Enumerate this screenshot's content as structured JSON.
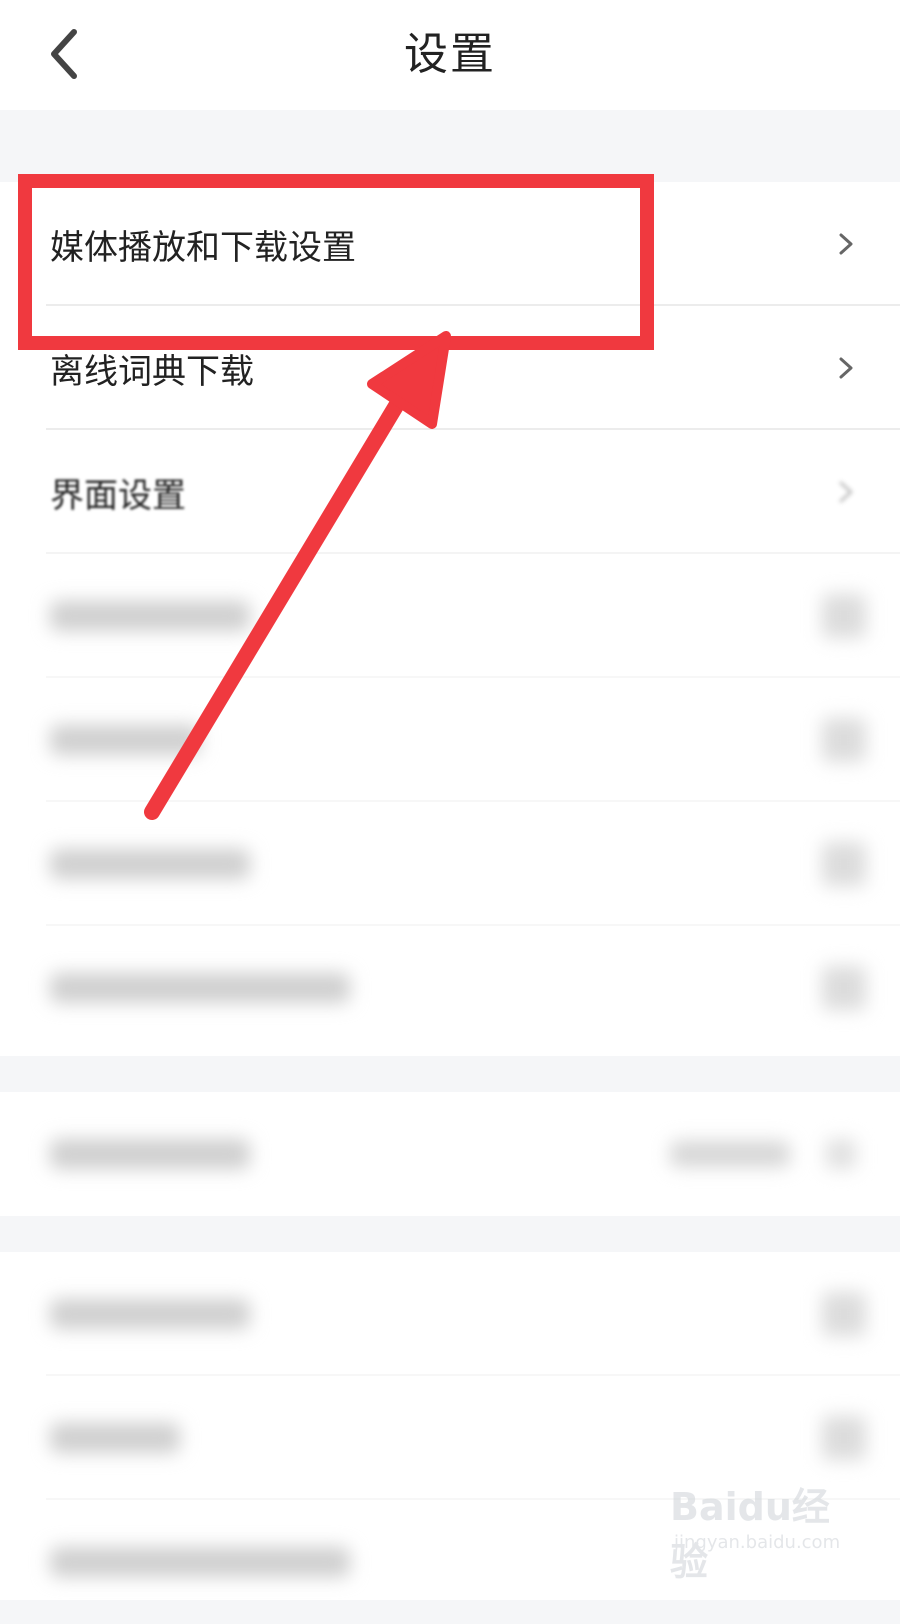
{
  "header": {
    "title": "设置",
    "back_icon": "chevron-left-icon"
  },
  "settings": {
    "group1": [
      {
        "label": "媒体播放和下载设置",
        "icon": "chevron-right-icon",
        "blurred": false
      },
      {
        "label": "离线词典下载",
        "icon": "chevron-right-icon",
        "blurred": false
      },
      {
        "label": "界面设置",
        "icon": "chevron-right-icon",
        "blurred": "partial"
      },
      {
        "label": "",
        "icon": "chevron-right-icon",
        "blurred": true
      },
      {
        "label": "",
        "icon": "chevron-right-icon",
        "blurred": true
      },
      {
        "label": "",
        "icon": "chevron-right-icon",
        "blurred": true
      },
      {
        "label": "",
        "icon": "chevron-right-icon",
        "blurred": true
      }
    ],
    "group2": [
      {
        "label": "",
        "value": "",
        "icon": "chevron-right-icon",
        "blurred": true
      }
    ],
    "group3": [
      {
        "label": "",
        "icon": "chevron-right-icon",
        "blurred": true
      },
      {
        "label": "",
        "icon": "chevron-right-icon",
        "blurred": true
      },
      {
        "label": "",
        "icon": "chevron-right-icon",
        "blurred": true
      }
    ]
  },
  "annotation": {
    "highlight_color": "#f0393f",
    "highlight_icon": "highlight-box",
    "arrow_icon": "arrow-pointer-icon"
  },
  "watermark": {
    "brand": "Baidu经验",
    "sub": "jingyan.baidu.com"
  },
  "colors": {
    "background": "#f5f6f8",
    "card": "#ffffff",
    "text": "#222222",
    "divider": "#ececec"
  }
}
